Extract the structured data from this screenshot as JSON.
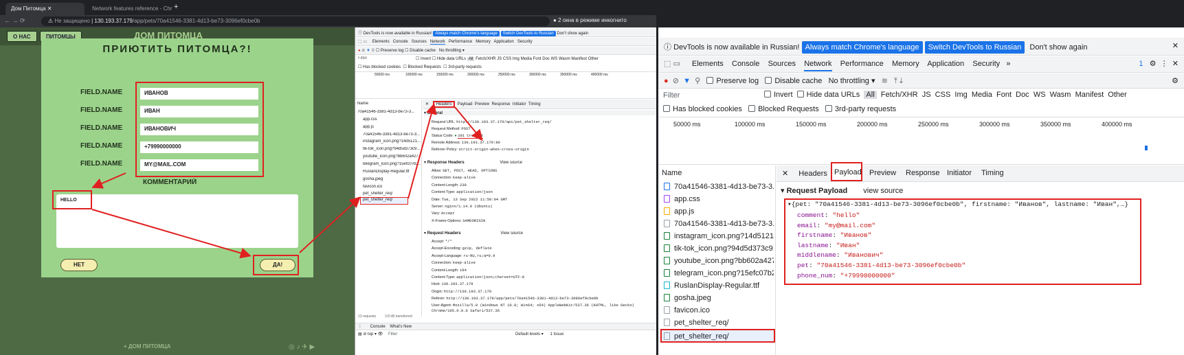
{
  "browser": {
    "tabs": [
      {
        "label": "Дом Питомца"
      },
      {
        "label": "Network features reference - Chr"
      }
    ],
    "security": "Не защищено",
    "url_host": "130.193.37.179",
    "url_path": "/app/pets/70a41546-3381-4d13-be73-3096ef0cbe0b",
    "incognito": "2 окна в режиме инкогнито"
  },
  "site": {
    "nav": [
      "О НАС",
      "ПИТОМЦЫ"
    ],
    "brand": "ДОМ ПИТОМЦА",
    "footer": "+ ДОМ ПИТОМЦА",
    "modal": {
      "title": "ПРИЮТИТЬ ПИТОМЦА?!",
      "field_label": "FIELD.NAME",
      "fields": [
        "ИВАНОВ",
        "ИВАН",
        "ИВАНОВИЧ",
        "+79990000000",
        "MY@MAIL.COM"
      ],
      "comment_label": "КОММЕНТАРИЙ",
      "comment_value": "HELLO",
      "no": "НЕТ",
      "yes": "ДА!"
    }
  },
  "devtools_small": {
    "notice": "DevTools is now available in Russian!",
    "btn_match": "Always match Chrome's language",
    "btn_switch": "Switch DevTools to Russian",
    "dont_show": "Don't show again",
    "panels": [
      "Elements",
      "Console",
      "Sources",
      "Network",
      "Performance",
      "Memory",
      "Application",
      "Security"
    ],
    "issues": "1",
    "toolbar": {
      "preserve": "Preserve log",
      "cache": "Disable cache",
      "throttle": "No throttling"
    },
    "filter": "Filter",
    "invert": "Invert",
    "hide": "Hide data URLs",
    "types": [
      "All",
      "Fetch/XHR",
      "JS",
      "CSS",
      "Img",
      "Media",
      "Font",
      "Doc",
      "WS",
      "Wasm",
      "Manifest",
      "Other"
    ],
    "blocked_cookies": "Has blocked cookies",
    "blocked_req": "Blocked Requests",
    "third_party": "3rd-party requests",
    "ticks": [
      "50000 ms",
      "100000 ms",
      "150000 ms",
      "200000 ms",
      "250000 ms",
      "300000 ms",
      "350000 ms",
      "400000 ms"
    ],
    "name_header": "Name",
    "requests": [
      "70a41546-3381-4d13-be73-3...",
      "app.css",
      "app.js",
      "70a41546-3381-4d13-be73-3...",
      "instagram_icon.png?14d5121...",
      "tik-tok_icon.png?94d5d373c9...",
      "youtube_icon.png?bb602a427...",
      "telegram_icon.png?15efc07b2...",
      "RuslanDisplay-Regular.ttf",
      "gosha.jpeg",
      "favicon.ico",
      "pet_shelter_req/",
      "pet_shelter_req/"
    ],
    "status_left": "13 requests",
    "status_right": "3.8 kB transferred",
    "detail_tabs": [
      "Headers",
      "Payload",
      "Preview",
      "Response",
      "Initiator",
      "Timing"
    ],
    "general_title": "General",
    "general": [
      {
        "k": "Request URL:",
        "v": "http://130.193.37.179/api/pet_shelter_req/"
      },
      {
        "k": "Request Method:",
        "v": "POST"
      },
      {
        "k": "Status Code:",
        "v": "201 Created"
      },
      {
        "k": "Remote Address:",
        "v": "130.193.37.179:80"
      },
      {
        "k": "Referrer Policy:",
        "v": "strict-origin-when-cross-origin"
      }
    ],
    "resp_title": "Response Headers",
    "view_source": "View source",
    "resp": [
      {
        "k": "Allow:",
        "v": "GET, POST, HEAD, OPTIONS"
      },
      {
        "k": "Connection:",
        "v": "keep-alive"
      },
      {
        "k": "Content-Length:",
        "v": "238"
      },
      {
        "k": "Content-Type:",
        "v": "application/json"
      },
      {
        "k": "Date:",
        "v": "Tue, 13 Sep 2022 11:50:04 GMT"
      },
      {
        "k": "Server:",
        "v": "nginx/1.14.0 (Ubuntu)"
      },
      {
        "k": "Vary:",
        "v": "Accept"
      },
      {
        "k": "X-Frame-Options:",
        "v": "SAMEORIGIN"
      }
    ],
    "req_title": "Request Headers",
    "req": [
      {
        "k": "Accept:",
        "v": "*/*"
      },
      {
        "k": "Accept-Encoding:",
        "v": "gzip, deflate"
      },
      {
        "k": "Accept-Language:",
        "v": "ru-RU,ru;q=0.9"
      },
      {
        "k": "Connection:",
        "v": "keep-alive"
      },
      {
        "k": "Content-Length:",
        "v": "194"
      },
      {
        "k": "Content-Type:",
        "v": "application/json;charset=UTF-8"
      },
      {
        "k": "Host:",
        "v": "130.193.37.179"
      },
      {
        "k": "Origin:",
        "v": "http://130.193.37.179"
      },
      {
        "k": "Referer:",
        "v": "http://130.193.37.179/app/pets/70a41546-3381-4d13-be73-3096ef0cbe0b"
      },
      {
        "k": "User-Agent:",
        "v": "Mozilla/5.0 (Windows NT 10.0; Win64; x64) AppleWebKit/537.36 (KHTML, like Gecko) Chrome/105.0.0.0 Safari/537.36"
      }
    ],
    "drawer_tabs": [
      "Console",
      "What's New"
    ],
    "console_top": "top",
    "console_filter": "Filter",
    "levels": "Default levels",
    "issue_count": "1 Issue:"
  },
  "devtools_big": {
    "notice": "DevTools is now available in Russian!",
    "btn_match": "Always match Chrome's language",
    "btn_switch": "Switch DevTools to Russian",
    "dont_show": "Don't show again",
    "panels": [
      "Elements",
      "Console",
      "Sources",
      "Network",
      "Performance",
      "Memory",
      "Application",
      "Security"
    ],
    "issues": "1",
    "preserve": "Preserve log",
    "cache": "Disable cache",
    "throttle": "No throttling",
    "filter": "Filter",
    "invert": "Invert",
    "hide": "Hide data URLs",
    "types": [
      "All",
      "Fetch/XHR",
      "JS",
      "CSS",
      "Img",
      "Media",
      "Font",
      "Doc",
      "WS",
      "Wasm",
      "Manifest",
      "Other"
    ],
    "blocked_cookies": "Has blocked cookies",
    "blocked_req": "Blocked Requests",
    "third_party": "3rd-party requests",
    "ticks": [
      "50000 ms",
      "100000 ms",
      "150000 ms",
      "200000 ms",
      "250000 ms",
      "300000 ms",
      "350000 ms",
      "400000 ms"
    ],
    "name_header": "Name",
    "requests": [
      "70a41546-3381-4d13-be73-3...",
      "app.css",
      "app.js",
      "70a41546-3381-4d13-be73-3...",
      "instagram_icon.png?14d5121...",
      "tik-tok_icon.png?94d5d373c9...",
      "youtube_icon.png?bb602a427...",
      "telegram_icon.png?15efc07b2...",
      "RuslanDisplay-Regular.ttf",
      "gosha.jpeg",
      "favicon.ico",
      "pet_shelter_req/",
      "pet_shelter_req/"
    ],
    "detail_tabs": [
      "Headers",
      "Payload",
      "Preview",
      "Response",
      "Initiator",
      "Timing"
    ],
    "payload_title": "Request Payload",
    "view_source": "view source",
    "summary": "{pet: \"70a41546-3381-4d13-be73-3096ef0cbe0b\", firstname: \"Иванов\", lastname: \"Иван\",…}",
    "payload": [
      {
        "k": "comment",
        "v": "\"hello\""
      },
      {
        "k": "email",
        "v": "\"my@mail.com\""
      },
      {
        "k": "firstname",
        "v": "\"Иванов\""
      },
      {
        "k": "lastname",
        "v": "\"Иван\""
      },
      {
        "k": "middlename",
        "v": "\"Иванович\""
      },
      {
        "k": "pet",
        "v": "\"70a41546-3381-4d13-be73-3096ef0cbe0b\""
      },
      {
        "k": "phone_num",
        "v": "\"+79990000000\""
      }
    ]
  },
  "colors": {
    "highlight": "#e02020",
    "accent": "#1a73e8",
    "modal": "#9bd38b"
  }
}
